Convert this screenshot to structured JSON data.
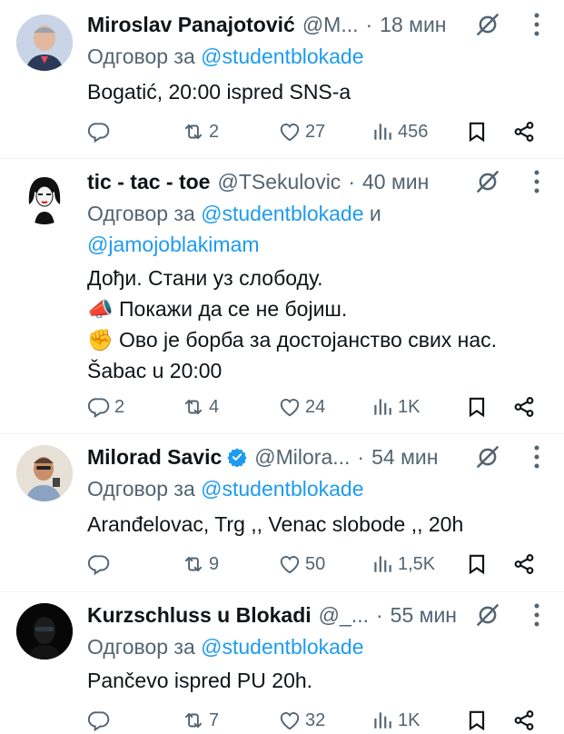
{
  "reply_prefix": "Одговор за",
  "tweets": [
    {
      "name": "Miroslav Panajotović",
      "handle": "@M...",
      "dot": "·",
      "time": "18 мин",
      "mentions": [
        "@studentblokade"
      ],
      "text_lines": [
        "Bogatić, 20:00 ispred SNS-a"
      ],
      "replies": "",
      "retweets": "2",
      "likes": "27",
      "views": "456"
    },
    {
      "name": "tic - tac - toe",
      "handle": "@TSekulovic",
      "dot": "·",
      "time": "40 мин",
      "mentions": [
        "@studentblokade",
        "и",
        "@jamojoblakimam"
      ],
      "text_lines": [
        "Дођи. Стани уз слободу.",
        "📣 Покажи да се не бојиш.",
        "✊ Ово је борба за достојанство свих нас.",
        "Šabac u 20:00"
      ],
      "replies": "2",
      "retweets": "4",
      "likes": "24",
      "views": "1K"
    },
    {
      "name": "Milorad Savic",
      "verified": true,
      "handle": "@Milora...",
      "dot": "·",
      "time": "54 мин",
      "mentions": [
        "@studentblokade"
      ],
      "text_lines": [
        "Aranđelovac, Trg ,, Venac slobode ,, 20h"
      ],
      "replies": "",
      "retweets": "9",
      "likes": "50",
      "views": "1,5K"
    },
    {
      "name": "Kurzschluss u Blokadi",
      "handle": "@_...",
      "dot": "·",
      "time": "55 мин",
      "mentions": [
        "@studentblokade"
      ],
      "text_lines": [
        "Pančevo ispred PU 20h."
      ],
      "replies": "",
      "retweets": "7",
      "likes": "32",
      "views": "1K"
    }
  ],
  "colors": {
    "text": "#0f1419",
    "muted": "#536471",
    "link": "#1d9bf0",
    "verified": "#1d9bf0",
    "divider": "#eff3f4"
  },
  "icons": {
    "reply": "reply-icon",
    "retweet": "retweet-icon",
    "like": "heart-icon",
    "views": "views-icon",
    "bookmark": "bookmark-icon",
    "share": "share-icon",
    "grok": "grok-icon",
    "more": "more-icon",
    "verified": "verified-badge-icon"
  }
}
